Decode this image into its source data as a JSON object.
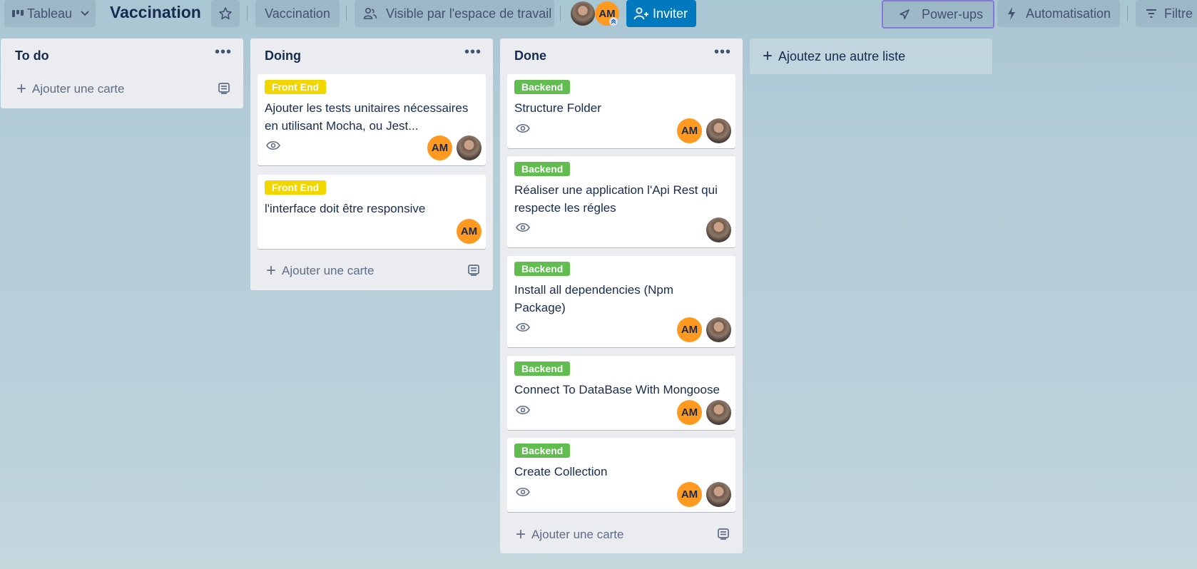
{
  "header": {
    "view_switcher": "Tableau",
    "board_title": "Vaccination",
    "workspace": "Vaccination",
    "visibility": "Visible par l'espace de travail",
    "member_initials": "AM",
    "invite": "Inviter",
    "power_ups": "Power-ups",
    "automation": "Automatisation",
    "filter": "Filtre"
  },
  "lists": [
    {
      "title": "To do",
      "add_card": "Ajouter une carte"
    },
    {
      "title": "Doing",
      "add_card": "Ajouter une carte"
    },
    {
      "title": "Done",
      "add_card": "Ajouter une carte"
    }
  ],
  "cards": {
    "doing": [
      {
        "label": "Front End",
        "title": "Ajouter les tests unitaires nécessaires en utilisant Mocha, ou Jest...",
        "members": [
          "AM",
          "photo"
        ]
      },
      {
        "label": "Front End",
        "title": "l'interface doit être responsive",
        "members": [
          "AM"
        ]
      }
    ],
    "done": [
      {
        "label": "Backend",
        "title": "Structure Folder",
        "members": [
          "AM",
          "photo"
        ]
      },
      {
        "label": "Backend",
        "title": "Réaliser une application l'Api Rest qui respecte les régles",
        "members": [
          "photo"
        ]
      },
      {
        "label": "Backend",
        "title": "Install all dependencies (Npm Package)",
        "members": [
          "AM",
          "photo"
        ]
      },
      {
        "label": "Backend",
        "title": "Connect To DataBase With Mongoose",
        "members": [
          "AM",
          "photo"
        ]
      },
      {
        "label": "Backend",
        "title": "Create Collection",
        "members": [
          "AM",
          "photo"
        ]
      }
    ]
  },
  "add_list": "Ajoutez une autre liste",
  "colors": {
    "label_front_end": "#f2d600",
    "label_backend": "#61bd4f",
    "invite_button": "#0079bf",
    "avatar_am": "#ff991f",
    "list_background": "#ebecf0",
    "power_ups_outline": "#8777d9"
  }
}
